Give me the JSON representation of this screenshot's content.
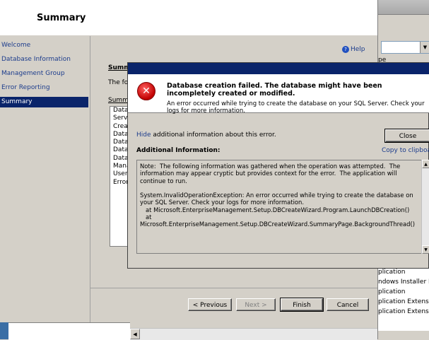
{
  "wizard": {
    "title": "Summary",
    "help_label": "Help",
    "nav": [
      {
        "label": "Welcome"
      },
      {
        "label": "Database Information"
      },
      {
        "label": "Management Group"
      },
      {
        "label": "Error Reporting"
      },
      {
        "label": "Summary",
        "selected": true
      }
    ],
    "summary_heading": "Summ",
    "summary_intro": "The fo",
    "summary_label": "Summar",
    "summary_items": [
      "Data",
      "Serve",
      "Crea",
      "Data",
      "Data",
      "Data",
      "Data",
      "Mana",
      "Users",
      "Error"
    ],
    "buttons": {
      "previous": "< Previous",
      "next": "Next >",
      "finish": "Finish",
      "cancel": "Cancel"
    }
  },
  "background_window": {
    "column_header_fragment": "pe",
    "list_items": [
      "plication",
      "ndows Installer P...",
      "plication",
      "plication Extension",
      "plication Extension"
    ]
  },
  "error_dialog": {
    "title": "Database creation failed. The database might have been incompletely created or modified.",
    "description": "An error occurred while trying to create the database on your SQL Server. Check your logs for more information.",
    "hide_link": "Hide",
    "hide_text": " additional information about this error.",
    "close_label": "Close",
    "additional_info_label": "Additional Information:",
    "copy_link": "Copy to clipboard",
    "details": "Note:  The following information was gathered when the operation was attempted.  The information may appear cryptic but provides context for the error.  The application will continue to run.\n\nSystem.InvalidOperationException: An error occurred while trying to create the database on your SQL Server. Check your logs for more information.\n   at Microsoft.EnterpriseManagement.Setup.DBCreateWizard.Program.LaunchDBCreation()\n   at Microsoft.EnterpriseManagement.Setup.DBCreateWizard.SummaryPage.BackgroundThread()"
  }
}
